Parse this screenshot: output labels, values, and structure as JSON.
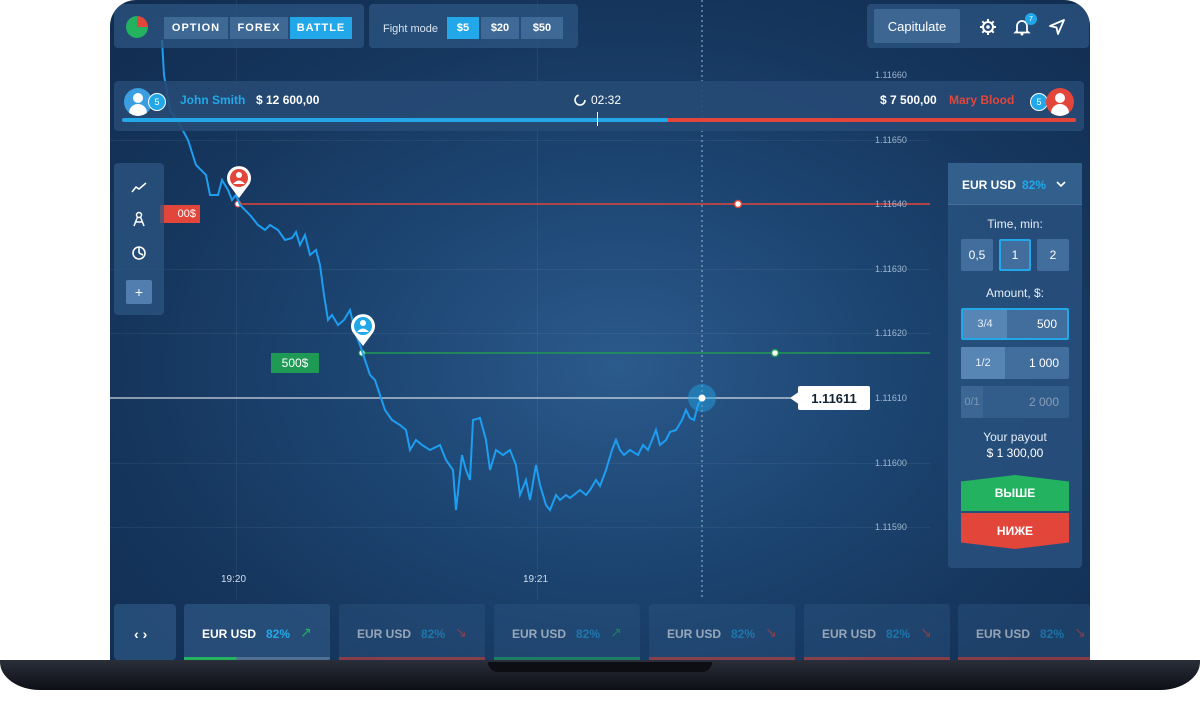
{
  "top": {
    "mode_tabs": [
      "OPTION",
      "FOREX",
      "BATTLE"
    ],
    "active_mode": "BATTLE",
    "fight_mode": {
      "label": "Fight mode",
      "options": [
        "$5",
        "$20",
        "$50"
      ],
      "selected": "$5"
    },
    "capitulate_label": "Capitulate",
    "notifications_count": "7"
  },
  "battle": {
    "player_left": {
      "level": "5",
      "name": "John Smith",
      "balance": "$ 12 600,00",
      "color": "#22a8e8"
    },
    "player_right": {
      "level": "5",
      "name": "Mary Blood",
      "balance": "$ 7 500,00",
      "color": "#e2463b"
    },
    "timer": "02:32"
  },
  "chart": {
    "y_ticks": [
      "1.11660",
      "1.11650",
      "1.11640",
      "1.11630",
      "1.11620",
      "1.11610",
      "1.11600",
      "1.11590"
    ],
    "x_ticks": [
      "19:20",
      "19:21"
    ],
    "current_price": "1.11611",
    "red_bet_label": "00$",
    "green_bet_label": "500$",
    "line_color": "#1e9ef0"
  },
  "trade_panel": {
    "pair": "EUR USD",
    "payout_pct": "82%",
    "time_label": "Time, min:",
    "time_options": [
      "0,5",
      "1",
      "2"
    ],
    "time_selected": "1",
    "amount_label": "Amount, $:",
    "amounts": [
      {
        "frac": "3/4",
        "value": "500"
      },
      {
        "frac": "1/2",
        "value": "1 000"
      },
      {
        "frac": "0/1",
        "value": "2 000"
      }
    ],
    "payout_label": "Your payout",
    "payout_value": "$ 1 300,00",
    "up_label": "ВЫШЕ",
    "down_label": "НИЖЕ"
  },
  "bottom": {
    "pairs": [
      {
        "name": "EUR USD",
        "pct": "82%",
        "arrow": "↗",
        "dir": "up"
      },
      {
        "name": "EUR USD",
        "pct": "82%",
        "arrow": "↘",
        "dir": "down"
      },
      {
        "name": "EUR USD",
        "pct": "82%",
        "arrow": "↗",
        "dir": "up"
      },
      {
        "name": "EUR USD",
        "pct": "82%",
        "arrow": "↘",
        "dir": "down"
      },
      {
        "name": "EUR USD",
        "pct": "82%",
        "arrow": "↘",
        "dir": "down"
      },
      {
        "name": "EUR USD",
        "pct": "82%",
        "arrow": "↘",
        "dir": "down"
      }
    ]
  }
}
